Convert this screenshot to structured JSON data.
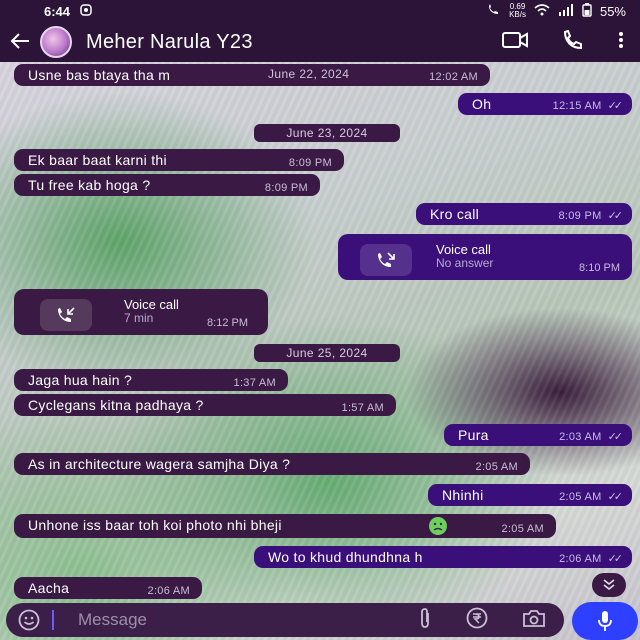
{
  "status_bar": {
    "time": "6:44",
    "speed_value": "0.69",
    "speed_unit": "KB/s",
    "battery": "55%"
  },
  "header": {
    "contact_name": "Meher Narula Y23"
  },
  "messages": [
    {
      "text": "Usne bas btaya tha m",
      "time": "12:02 AM",
      "overlay_date": "June 22, 2024",
      "direction": "in"
    },
    {
      "text": "Oh",
      "time": "12:15 AM",
      "direction": "out"
    },
    {
      "date": "June 23, 2024"
    },
    {
      "text": "Ek baar baat karni thi",
      "time": "8:09 PM",
      "direction": "in"
    },
    {
      "text": "Tu free kab hoga ?",
      "time": "8:09 PM",
      "direction": "in"
    },
    {
      "text": "Kro call",
      "time": "8:09 PM",
      "direction": "out"
    },
    {
      "call_title": "Voice call",
      "call_sub": "No answer",
      "time": "8:10 PM",
      "direction": "out"
    },
    {
      "call_title": "Voice call",
      "call_sub": "7 min",
      "time": "8:12 PM",
      "direction": "in"
    },
    {
      "date": "June 25, 2024"
    },
    {
      "text": "Jaga hua hain ?",
      "time": "1:37 AM",
      "direction": "in"
    },
    {
      "text": "Cyclegans kitna padhaya ?",
      "time": "1:57 AM",
      "direction": "in"
    },
    {
      "text": "Pura",
      "time": "2:03 AM",
      "direction": "out"
    },
    {
      "text": "As in architecture wagera samjha Diya ?",
      "time": "2:05 AM",
      "direction": "in"
    },
    {
      "text": "Nhinhi",
      "time": "2:05 AM",
      "direction": "out"
    },
    {
      "text": "Unhone iss baar toh koi photo nhi bheji",
      "emoji": "nauseated-face",
      "time": "2:05 AM",
      "direction": "in"
    },
    {
      "text": "Wo to khud dhundhna h",
      "time": "2:06 AM",
      "direction": "out"
    },
    {
      "text": "Aacha",
      "time": "2:06 AM",
      "direction": "in"
    }
  ],
  "composer": {
    "placeholder": "Message"
  },
  "icons": {
    "back": "arrow-left-icon",
    "video": "video-call-icon",
    "phone": "phone-icon",
    "menu": "more-vert-icon",
    "emoji": "emoji-icon",
    "attach": "paperclip-icon",
    "payment": "rupee-icon",
    "camera": "camera-icon",
    "mic": "mic-icon",
    "scroll": "double-chevron-down-icon"
  },
  "colors": {
    "header_bg": "#2b1437",
    "incoming_bubble": "#3a1a44",
    "outgoing_bubble": "#3a0f7a",
    "mic_button": "#2f3fff"
  }
}
